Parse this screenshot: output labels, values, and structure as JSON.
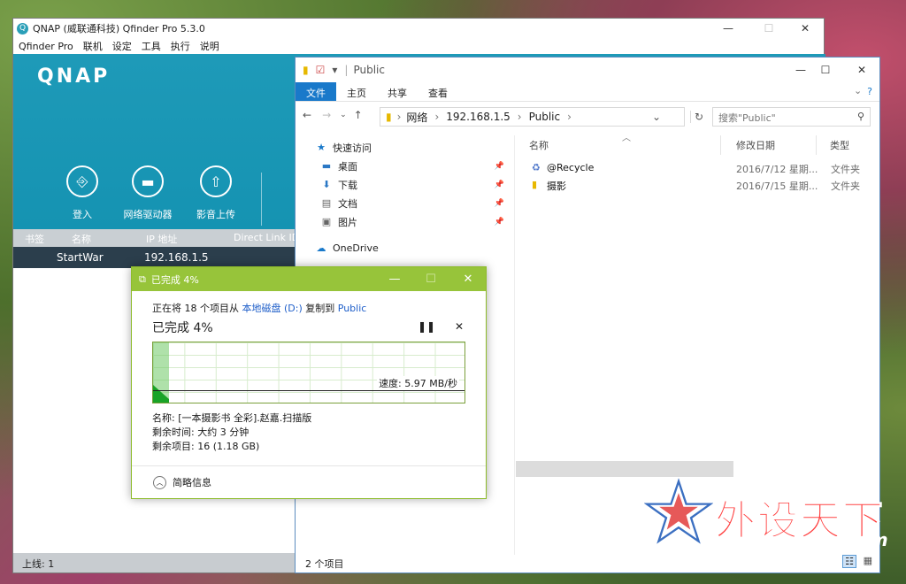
{
  "qfinder": {
    "title": "QNAP (威联通科技) Qfinder Pro 5.3.0",
    "menu": [
      "Qfinder Pro",
      "联机",
      "设定",
      "工具",
      "执行",
      "说明"
    ],
    "logo_text": "QNAP",
    "tools": [
      {
        "label": "登入",
        "icon": "login-icon"
      },
      {
        "label": "网络驱动器",
        "icon": "folder-icon"
      },
      {
        "label": "影音上传",
        "icon": "upload-icon"
      }
    ],
    "columns": [
      "书签",
      "名称",
      "IP 地址",
      "Direct Link ID"
    ],
    "rows": [
      {
        "name": "StartWar",
        "ip": "192.168.1.5"
      }
    ],
    "status": "上线: 1"
  },
  "explorer": {
    "title": "Public",
    "ribbon_tabs": [
      "文件",
      "主页",
      "共享",
      "查看"
    ],
    "breadcrumb": [
      "网络",
      "192.168.1.5",
      "Public"
    ],
    "search_placeholder": "搜索\"Public\"",
    "nav": {
      "quick_access": "快速访问",
      "items": [
        "桌面",
        "下载",
        "文档",
        "图片"
      ],
      "onedrive": "OneDrive"
    },
    "columns": [
      "名称",
      "修改日期",
      "类型"
    ],
    "files": [
      {
        "name": "@Recycle",
        "date": "2016/7/12 星期...",
        "type": "文件夹"
      },
      {
        "name": "摄影",
        "date": "2016/7/15 星期...",
        "type": "文件夹"
      }
    ],
    "status": "2 个项目"
  },
  "copy_dialog": {
    "title": "已完成 4%",
    "desc_prefix": "正在将 18 个项目从",
    "desc_source": "本地磁盘 (D:)",
    "desc_mid": "复制到",
    "desc_target": "Public",
    "percent_text": "已完成 4%",
    "progress": 0.04,
    "speed": "速度: 5.97 MB/秒",
    "name_line": "名称: [一本摄影书 全彩].赵嘉.扫描版",
    "time_line": "剩余时间: 大约 3 分钟",
    "items_line": "剩余项目: 16 (1.18 GB)",
    "details_label": "简略信息"
  },
  "watermark": {
    "text": "外设天下",
    "url": "www.wstx.com"
  }
}
